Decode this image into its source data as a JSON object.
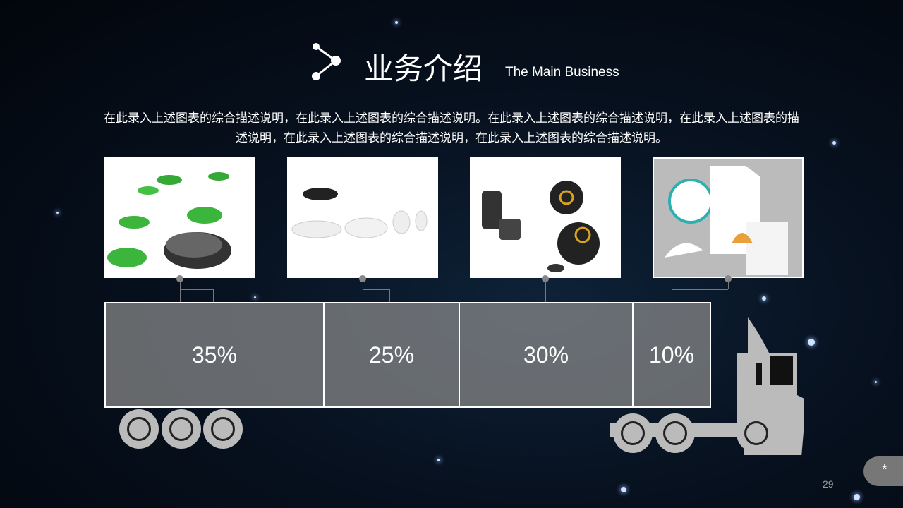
{
  "header": {
    "title": "业务介绍",
    "subtitle": "The Main Business",
    "icon": "share-nodes-icon"
  },
  "description": "在此录入上述图表的综合描述说明，在此录入上述图表的综合描述说明。在此录入上述图表的综合描述说明，在此录入上述图表的描述说明，在此录入上述图表的综合描述说明，在此录入上述图表的综合描述说明。",
  "photos": [
    "green-pebble-devices",
    "white-capsule-devices",
    "black-sphere-gadgets",
    "brand-identity-mockup"
  ],
  "truck": {
    "segments": [
      {
        "label": "35%",
        "value": 35
      },
      {
        "label": "25%",
        "value": 25
      },
      {
        "label": "30%",
        "value": 30
      },
      {
        "label": "10%",
        "value": 10
      }
    ],
    "color": "#8c8c8c"
  },
  "footer": {
    "page_number": "29",
    "button_label": "*"
  }
}
